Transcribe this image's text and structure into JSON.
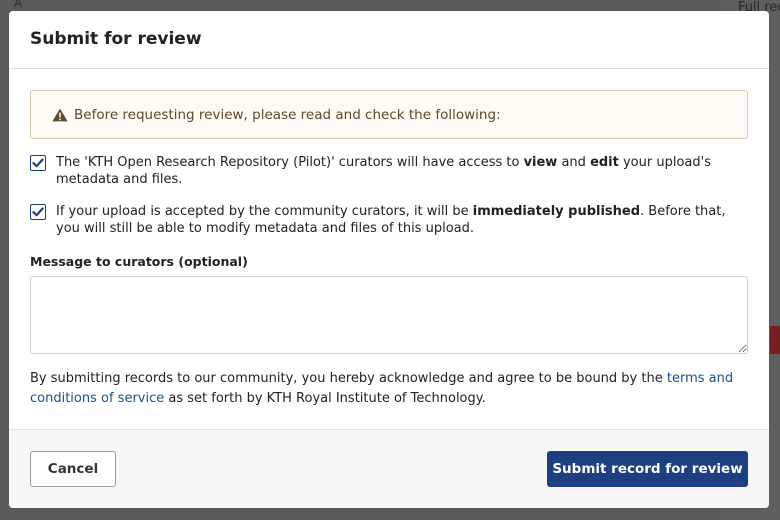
{
  "background": {
    "top_left_fragment": "A",
    "right_fragments": [
      "Full reco",
      "",
      "",
      ""
    ]
  },
  "modal": {
    "title": "Submit for review",
    "warning": {
      "icon": "warning-triangle-icon",
      "text": "Before requesting review, please read and check the following:"
    },
    "checks": [
      {
        "checked": true,
        "text_before": "The 'KTH Open Research Repository (Pilot)' curators will have access to ",
        "bold1": "view",
        "text_mid": " and ",
        "bold2": "edit",
        "text_after": " your upload's metadata and files."
      },
      {
        "checked": true,
        "text_before": "If your upload is accepted by the community curators, it will be ",
        "bold1": "immediately published",
        "text_after": ". Before that, you will still be able to modify metadata and files of this upload."
      }
    ],
    "message_label": "Message to curators (optional)",
    "message_value": "",
    "terms": {
      "text_before": "By submitting records to our community, you hereby acknowledge and agree to be bound by the ",
      "link_text": "terms and conditions of service",
      "text_after": " as set forth by KTH Royal Institute of Technology."
    },
    "footer": {
      "cancel_label": "Cancel",
      "submit_label": "Submit record for review"
    }
  },
  "colors": {
    "primary": "#1e3f80",
    "link": "#1c4f8f",
    "warning_bg": "#fffaf3",
    "warning_border": "#d9c9a7"
  }
}
